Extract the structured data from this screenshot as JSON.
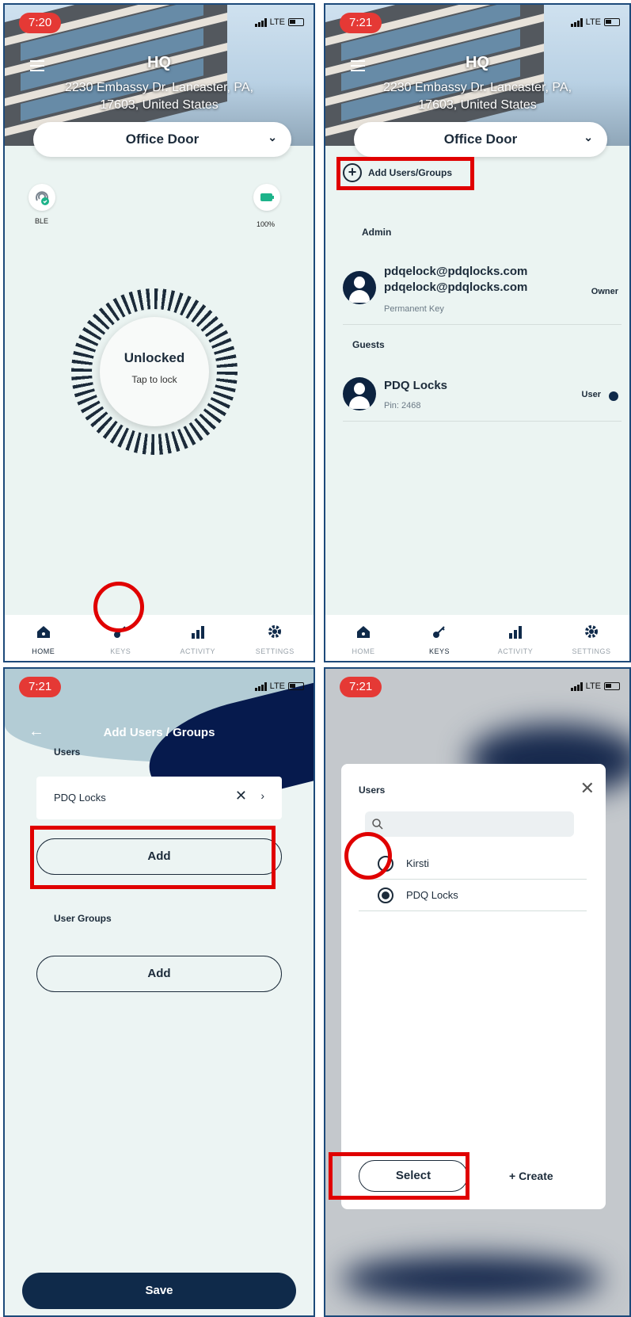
{
  "status": {
    "time_1": "7:20",
    "time_2": "7:21",
    "time_3": "7:21",
    "time_4": "7:21",
    "network": "LTE"
  },
  "hero": {
    "title": "HQ",
    "address_line1": "2230 Embassy Dr. Lancaster, PA,",
    "address_line2": "17603, United States"
  },
  "door_selector": {
    "value": "Office Door"
  },
  "home": {
    "ble_label": "BLE",
    "battery_level": "100%",
    "lock_state": "Unlocked",
    "lock_hint": "Tap to lock"
  },
  "tabs": [
    "HOME",
    "KEYS",
    "ACTIVITY",
    "SETTINGS"
  ],
  "keys": {
    "add_label": "Add Users/Groups",
    "admin_section": "Admin",
    "guests_section": "Guests",
    "admin_user": {
      "name": "pdqelock@pdqlocks.com",
      "email": "pdqelock@pdqlocks.com",
      "key_type": "Permanent Key",
      "role": "Owner"
    },
    "guest_user": {
      "name": "PDQ Locks",
      "pin": "Pin: 2468",
      "role": "User"
    }
  },
  "add_users_groups": {
    "title": "Add Users / Groups",
    "users_label": "Users",
    "selected_user": "PDQ Locks",
    "add_button": "Add",
    "groups_label": "User Groups",
    "groups_add_button": "Add",
    "save_button": "Save"
  },
  "user_picker": {
    "title": "Users",
    "options": [
      {
        "name": "Kirsti",
        "selected": false
      },
      {
        "name": "PDQ Locks",
        "selected": true
      }
    ],
    "select_button": "Select",
    "create_button": "+ Create"
  },
  "colors": {
    "highlight": "#e00000",
    "navy": "#0f2a4a",
    "status_pill": "#e53935",
    "battery": "#1db38a"
  }
}
